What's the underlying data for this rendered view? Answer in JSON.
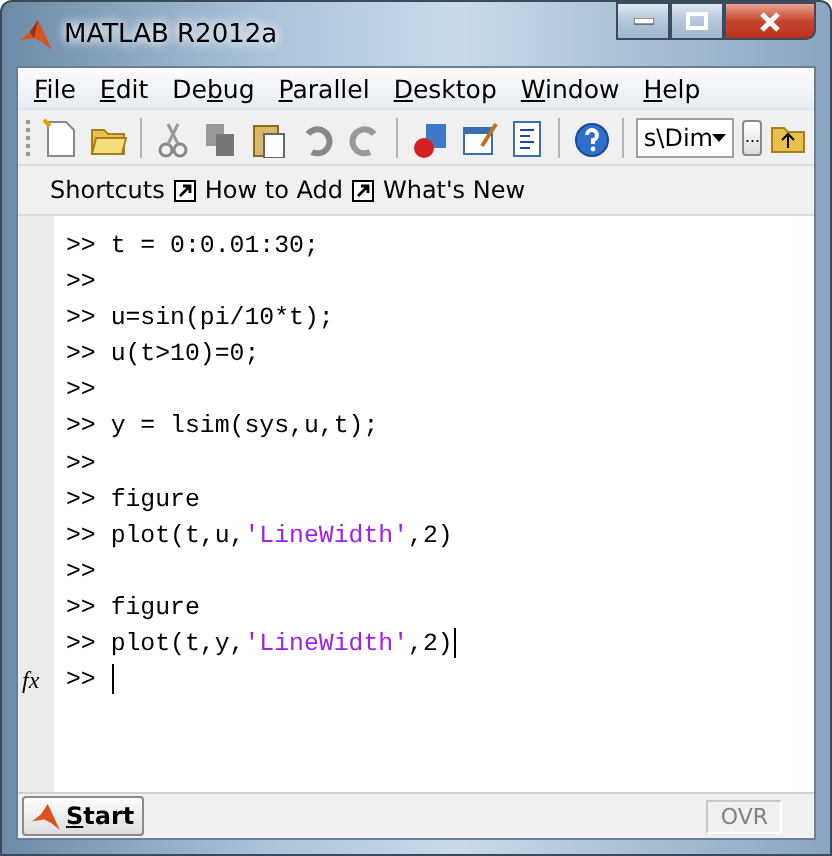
{
  "window": {
    "title": "MATLAB  R2012a"
  },
  "menu": [
    {
      "mnemonic": "F",
      "rest": "ile"
    },
    {
      "mnemonic": "E",
      "rest": "dit"
    },
    {
      "before": "De",
      "mnemonic": "b",
      "rest": "ug"
    },
    {
      "mnemonic": "P",
      "rest": "arallel"
    },
    {
      "mnemonic": "D",
      "rest": "esktop"
    },
    {
      "mnemonic": "W",
      "rest": "indow"
    },
    {
      "mnemonic": "H",
      "rest": "elp"
    }
  ],
  "toolbar": {
    "current_folder": "s\\Dim",
    "browse_button": "..."
  },
  "shortcuts": [
    {
      "label": "Shortcuts",
      "kind": "plain"
    },
    {
      "label": "How to Add",
      "kind": "link"
    },
    {
      "label": "What's New",
      "kind": "link"
    }
  ],
  "command_window": {
    "prompt": ">>",
    "function_browser": "fx",
    "lines": [
      {
        "kind": "command",
        "segments": [
          {
            "text": "t = 0:0.01:30;",
            "kind": "code"
          }
        ]
      },
      {
        "kind": "blank"
      },
      {
        "kind": "command",
        "segments": [
          {
            "text": "u=sin(pi/10*t);",
            "kind": "code"
          }
        ]
      },
      {
        "kind": "command",
        "segments": [
          {
            "text": "u(t>10)=0;",
            "kind": "code"
          }
        ]
      },
      {
        "kind": "blank"
      },
      {
        "kind": "command",
        "segments": [
          {
            "text": "y = lsim(sys,u,t);",
            "kind": "code"
          }
        ]
      },
      {
        "kind": "blank"
      },
      {
        "kind": "command",
        "segments": [
          {
            "text": "figure",
            "kind": "code"
          }
        ]
      },
      {
        "kind": "command",
        "segments": [
          {
            "text": "plot(t,u,",
            "kind": "code"
          },
          {
            "text": "'LineWidth'",
            "kind": "string"
          },
          {
            "text": ",2)",
            "kind": "code"
          }
        ]
      },
      {
        "kind": "blank"
      },
      {
        "kind": "command",
        "segments": [
          {
            "text": "figure",
            "kind": "code"
          }
        ]
      },
      {
        "kind": "command",
        "segments": [
          {
            "text": "plot(t,y,",
            "kind": "code"
          },
          {
            "text": "'LineWidth'",
            "kind": "string"
          },
          {
            "text": ",2)",
            "kind": "code"
          }
        ]
      }
    ]
  },
  "status_bar": {
    "start": {
      "mnemonic": "S",
      "rest": "tart"
    },
    "ovr": "OVR"
  }
}
